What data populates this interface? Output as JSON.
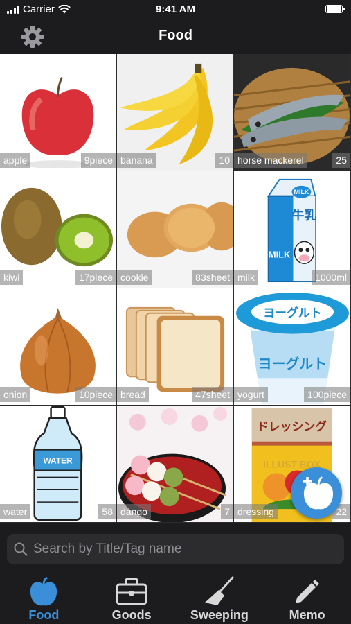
{
  "status_bar": {
    "carrier": "Carrier",
    "time": "9:41 AM"
  },
  "nav": {
    "title": "Food",
    "settings_icon": "gear-icon"
  },
  "items": [
    {
      "name": "apple",
      "qty": "9piece"
    },
    {
      "name": "banana",
      "qty": "10"
    },
    {
      "name": "horse mackerel",
      "qty": "25"
    },
    {
      "name": "kiwi",
      "qty": "17piece"
    },
    {
      "name": "cookie",
      "qty": "83sheet"
    },
    {
      "name": "milk",
      "qty": "1000ml"
    },
    {
      "name": "onion",
      "qty": "10piece"
    },
    {
      "name": "bread",
      "qty": "47sheet"
    },
    {
      "name": "yogurt",
      "qty": "100piece"
    },
    {
      "name": "water",
      "qty": "58"
    },
    {
      "name": "dango",
      "qty": "7"
    },
    {
      "name": "dressing",
      "qty": "22"
    }
  ],
  "image_text": {
    "milk_brand": "MILK",
    "milk_kanji": "牛乳",
    "yogurt_label": "ヨーグルト",
    "water_label": "WATER",
    "dressing_label": "ドレッシング",
    "dressing_watermark": "ILLUST BOX"
  },
  "search": {
    "placeholder": "Search by Title/Tag name"
  },
  "tabs": [
    {
      "label": "Food",
      "icon": "apple-icon",
      "active": true
    },
    {
      "label": "Goods",
      "icon": "toolbox-icon",
      "active": false
    },
    {
      "label": "Sweeping",
      "icon": "broom-icon",
      "active": false
    },
    {
      "label": "Memo",
      "icon": "pencil-icon",
      "active": false
    }
  ],
  "colors": {
    "accent": "#3a8fd8",
    "background": "#1c1c1e",
    "search_field": "#2c2c2e"
  }
}
